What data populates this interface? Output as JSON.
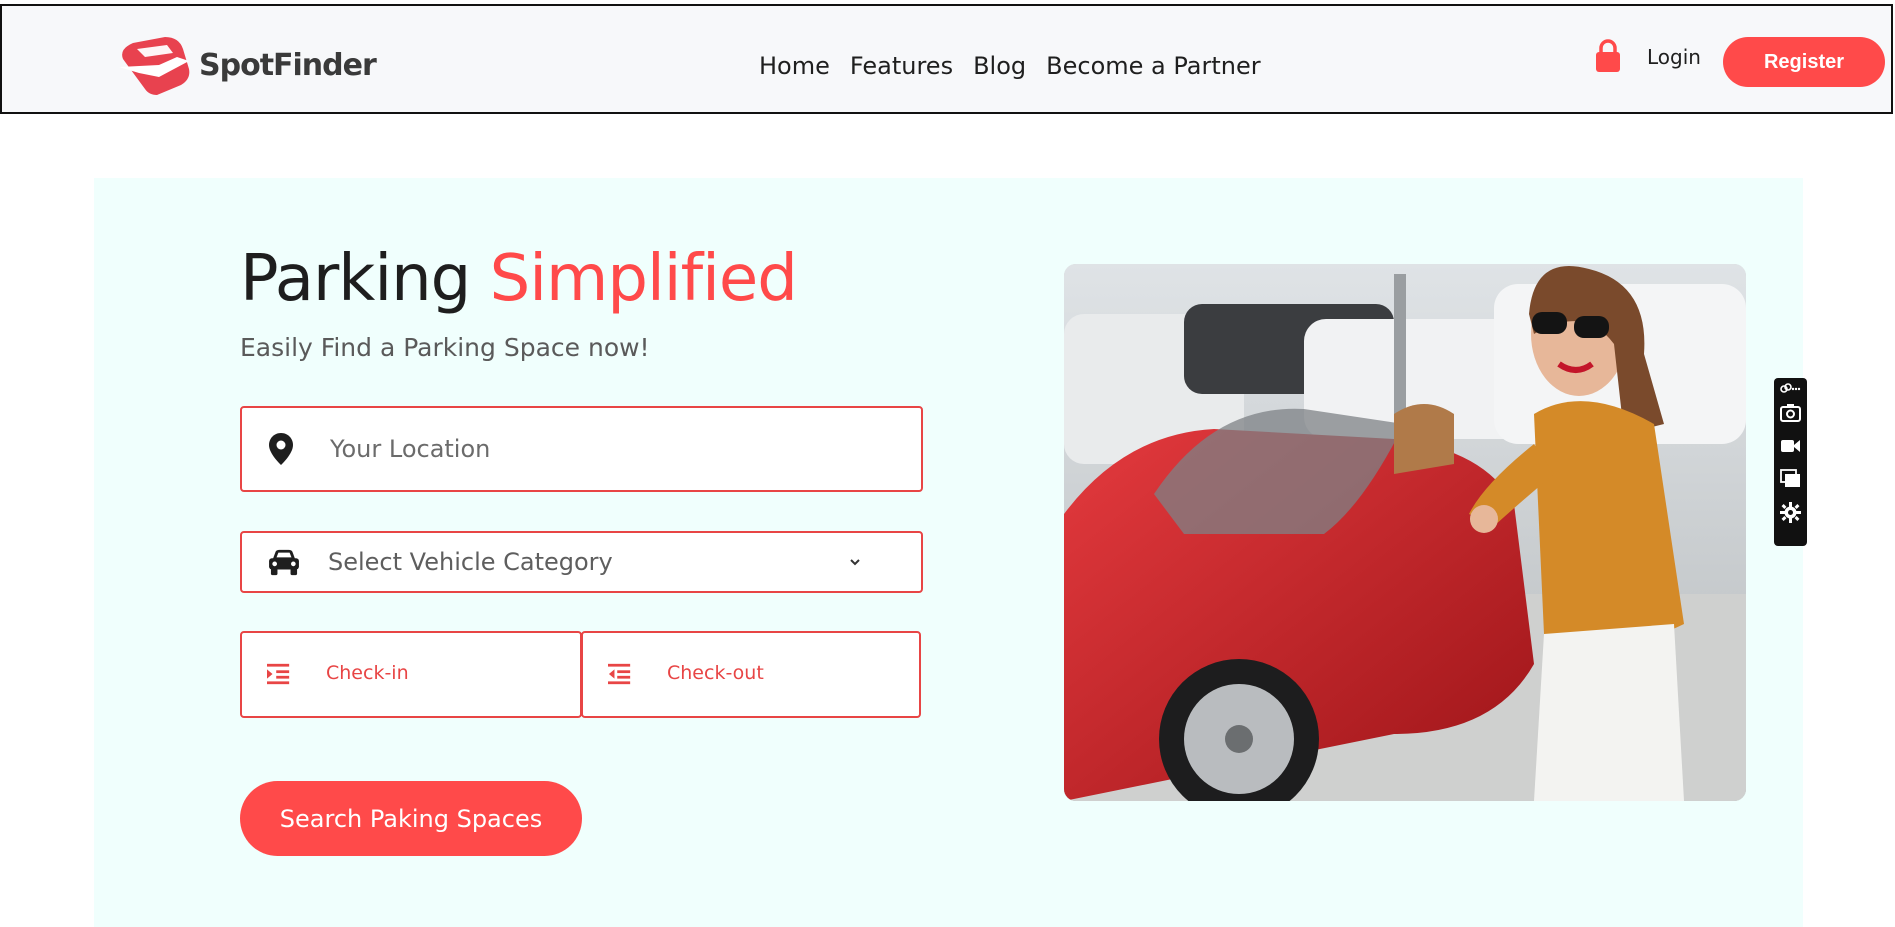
{
  "header": {
    "brand": "SpotFinder",
    "nav": [
      {
        "label": "Home"
      },
      {
        "label": "Features"
      },
      {
        "label": "Blog"
      },
      {
        "label": "Become a Partner"
      }
    ],
    "login_label": "Login",
    "register_label": "Register"
  },
  "hero": {
    "title_main": "Parking ",
    "title_accent": "Simplified",
    "subtitle": "Easily Find a Parking Space now!",
    "location_placeholder": "Your Location",
    "vehicle_select": "Select Vehicle Category",
    "checkin_label": "Check-in",
    "checkout_label": "Check-out",
    "search_button": "Search Paking Spaces"
  },
  "icons": {
    "logo": "spotfinder-logo",
    "lock": "lock-icon",
    "location": "map-pin-icon",
    "vehicle": "car-icon",
    "dropdown": "chevron-down-icon",
    "checkin": "calendar-indent-icon",
    "checkout": "calendar-indent-icon",
    "toolbar": [
      "link-more-icon",
      "camera-icon",
      "video-icon",
      "windows-icon",
      "gear-icon"
    ]
  },
  "colors": {
    "accent": "#ff4a4a",
    "field_border": "#e84545",
    "hero_bg": "#f0fffd",
    "header_bg": "#f7f8fa"
  }
}
